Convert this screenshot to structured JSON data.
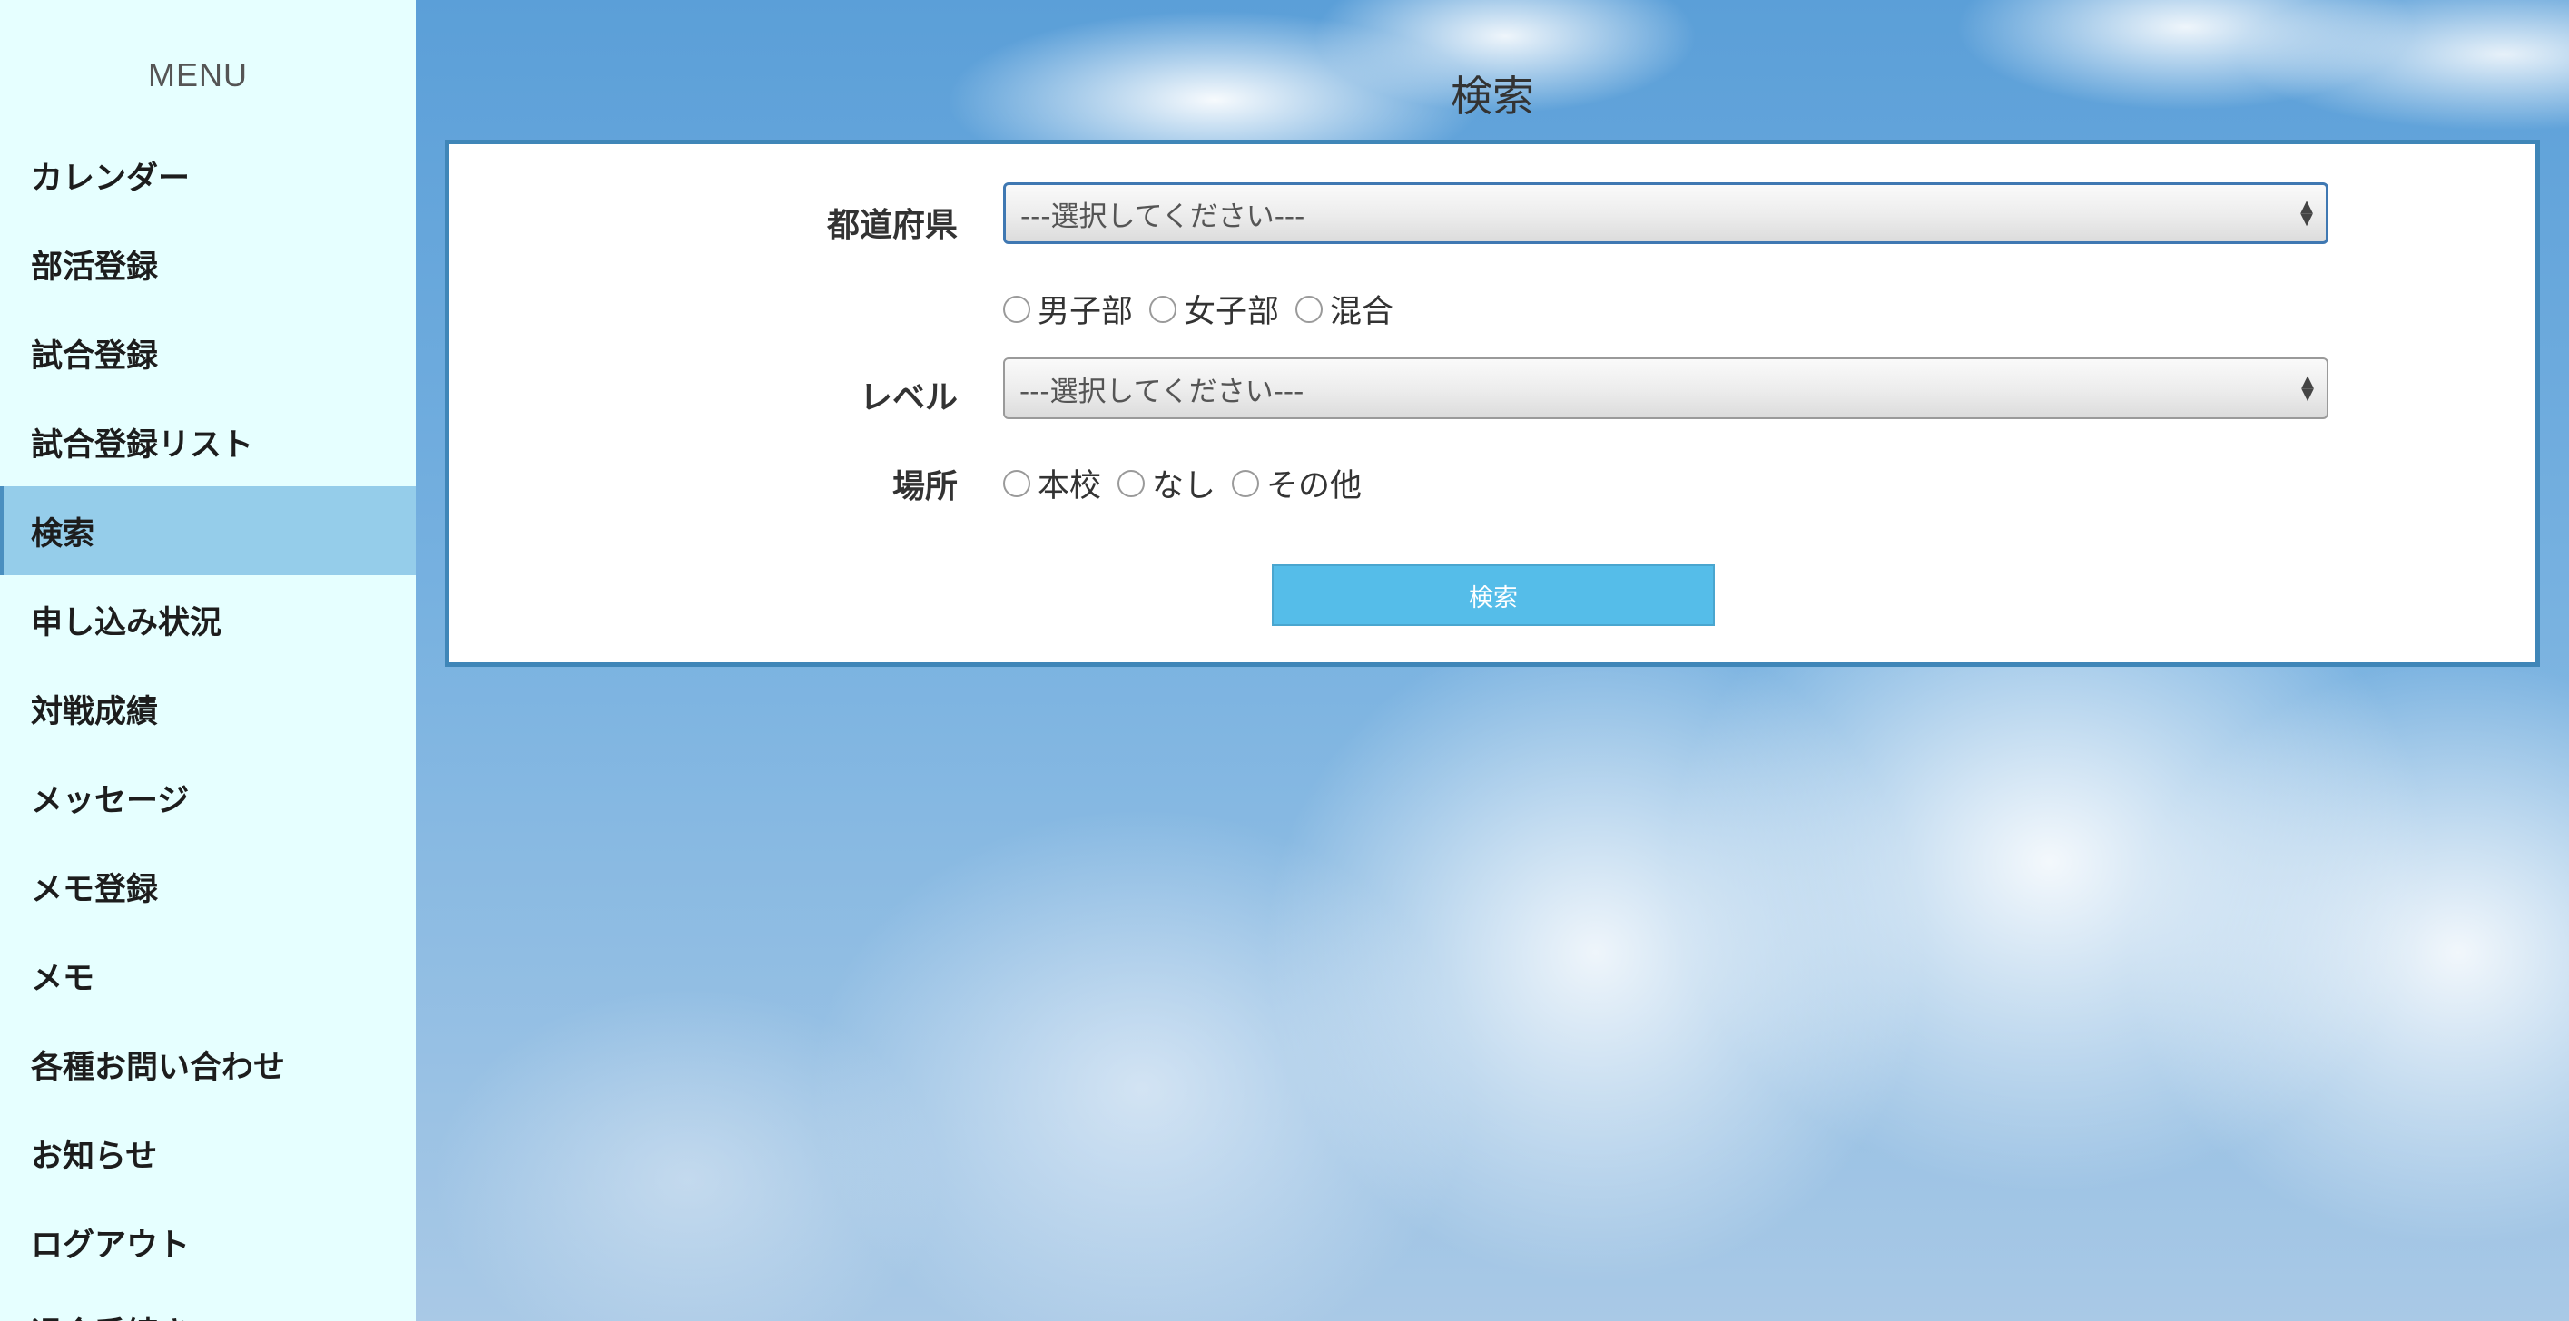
{
  "sidebar": {
    "menu_title": "MENU",
    "items": [
      {
        "label": "カレンダー"
      },
      {
        "label": "部活登録"
      },
      {
        "label": "試合登録"
      },
      {
        "label": "試合登録リスト"
      },
      {
        "label": "検索",
        "active": true
      },
      {
        "label": "申し込み状況"
      },
      {
        "label": "対戦成績"
      },
      {
        "label": "メッセージ"
      },
      {
        "label": "メモ登録"
      },
      {
        "label": "メモ"
      },
      {
        "label": "各種お問い合わせ"
      },
      {
        "label": "お知らせ"
      },
      {
        "label": "ログアウト"
      },
      {
        "label": "退会手続き"
      }
    ]
  },
  "main": {
    "title": "検索",
    "form": {
      "prefecture": {
        "label": "都道府県",
        "selected": "---選択してください---"
      },
      "gender": {
        "options": [
          "男子部",
          "女子部",
          "混合"
        ]
      },
      "level": {
        "label": "レベル",
        "selected": "---選択してください---"
      },
      "location": {
        "label": "場所",
        "options": [
          "本校",
          "なし",
          "その他"
        ]
      },
      "submit_label": "検索"
    }
  },
  "colors": {
    "sidebar_bg": "#e6ffff",
    "active_item_bg": "#95cdea",
    "panel_border": "#3f86b8",
    "button_bg": "#55bde9"
  }
}
